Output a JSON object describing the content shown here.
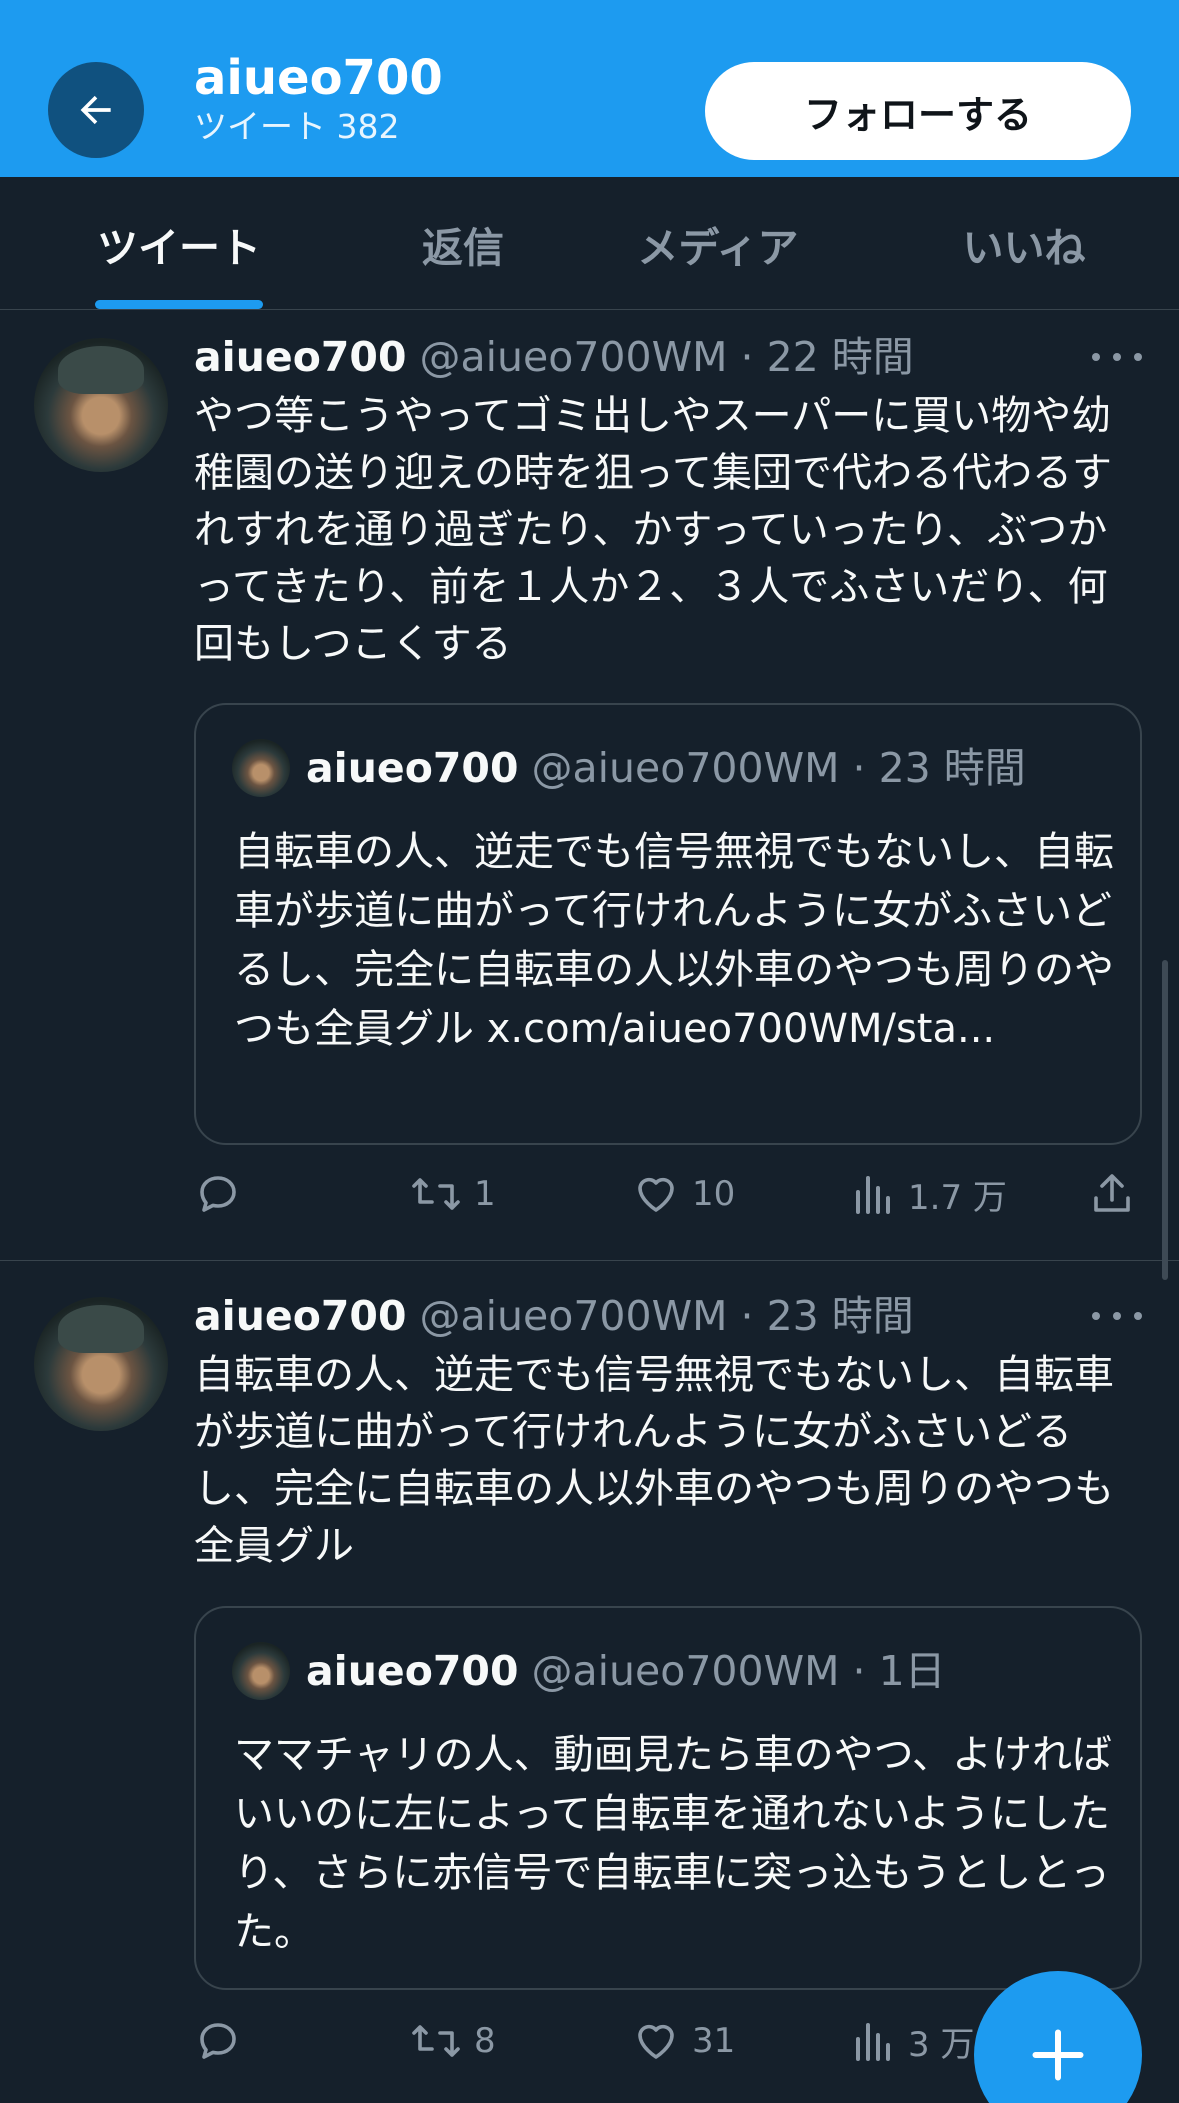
{
  "header": {
    "back_icon": "arrow-left-icon",
    "name": "aiueo700",
    "tweet_count": "ツイート 382",
    "follow_label": "フォローする"
  },
  "tabs": [
    {
      "label": "ツイート",
      "active": true
    },
    {
      "label": "返信",
      "active": false
    },
    {
      "label": "メディア",
      "active": false
    },
    {
      "label": "いいね",
      "active": false
    }
  ],
  "tweets": [
    {
      "name": "aiueo700",
      "handle_time": "@aiueo700WM · 22 時間",
      "text": "やつ等こうやってゴミ出しやスーパーに買い物や幼稚園の送り迎えの時を狙って集団で代わる代わるすれすれを通り過ぎたり、かすっていったり、ぶつかってきたり、前を１人か２、３人でふさいだり、何回もしつこくする",
      "quote": {
        "name": "aiueo700",
        "handle_time": "@aiueo700WM · 23 時間",
        "text": "自転車の人、逆走でも信号無視でもないし、自転車が歩道に曲がって行けれんように女がふさいどるし、完全に自転車の人以外車のやつも周りのやつも全員グル x.com/aiueo700WM/sta..."
      },
      "actions": {
        "reply_count": "",
        "retweet_count": "1",
        "like_count": "10",
        "view_count": "1.7 万"
      }
    },
    {
      "name": "aiueo700",
      "handle_time": "@aiueo700WM · 23 時間",
      "text": "自転車の人、逆走でも信号無視でもないし、自転車が歩道に曲がって行けれんように女がふさいどるし、完全に自転車の人以外車のやつも周りのやつも全員グル",
      "quote": {
        "name": "aiueo700",
        "handle_time": "@aiueo700WM · 1日",
        "text": "ママチャリの人、動画見たら車のやつ、よければいいのに左によって自転車を通れないようにしたり、さらに赤信号で自転車に突っ込もうとしとった。"
      },
      "actions": {
        "reply_count": "",
        "retweet_count": "8",
        "like_count": "31",
        "view_count": "3 万"
      }
    }
  ],
  "fab": {
    "icon": "plus-icon"
  },
  "colors": {
    "accent": "#1d9bf0",
    "background": "#15202b",
    "muted_text": "#8b98a5",
    "border": "#38444d"
  }
}
